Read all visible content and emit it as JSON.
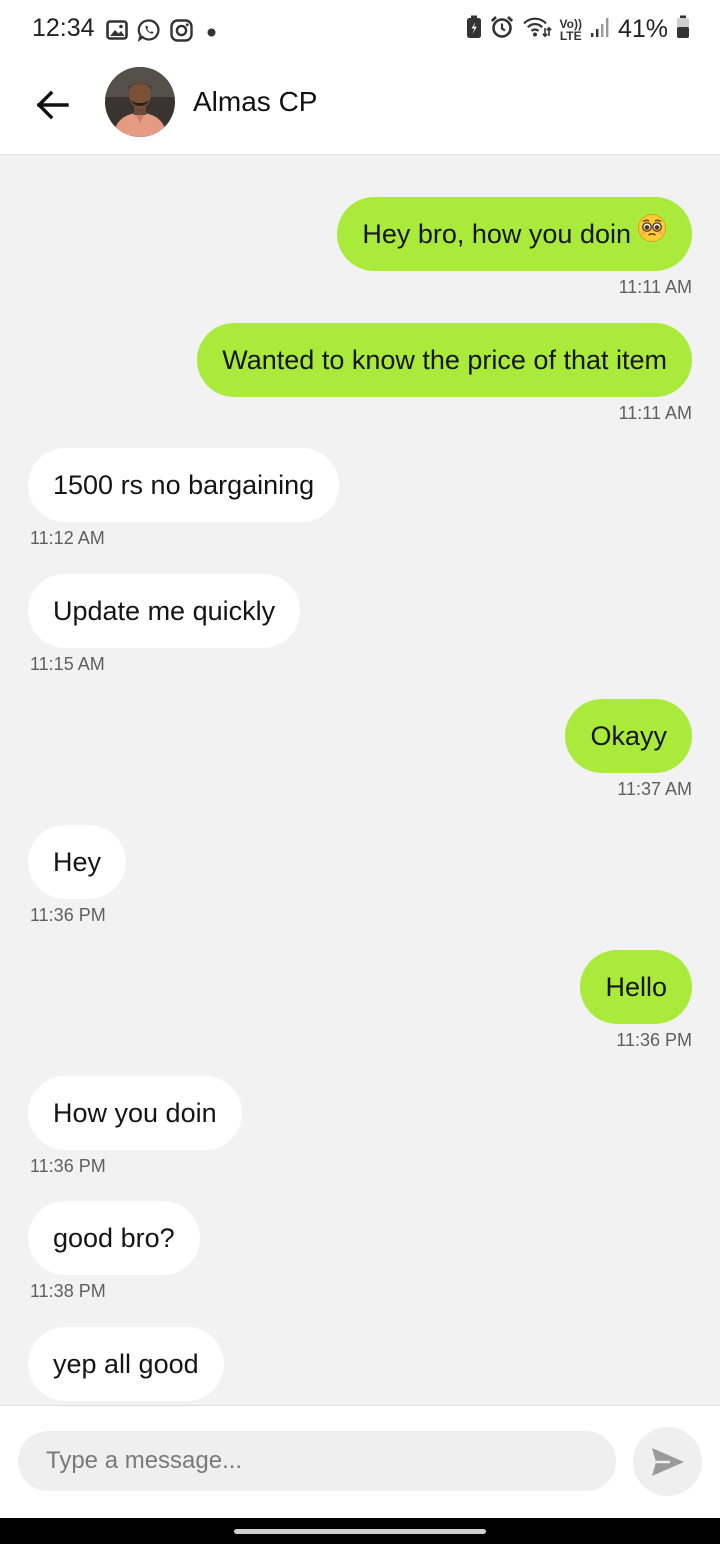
{
  "status_bar": {
    "time": "12:34",
    "battery_percent": "41%",
    "network_label_top": "Vo))",
    "network_label_bottom": "LTE",
    "left_icons": [
      "gallery-icon",
      "whatsapp-icon",
      "instagram-icon",
      "dot-icon"
    ],
    "right_icons": [
      "battery-saver-icon",
      "alarm-icon",
      "wifi-icon",
      "volte-icon",
      "signal-icon",
      "battery-icon"
    ]
  },
  "header": {
    "contact_name": "Almas CP",
    "back_icon": "arrow-left-icon"
  },
  "messages": [
    {
      "direction": "sent",
      "text": "Hey bro, how you doin",
      "emoji": "pleading-face-emoji",
      "time": "11:11 AM"
    },
    {
      "direction": "sent",
      "text": "Wanted to know the price of that item",
      "time": "11:11 AM"
    },
    {
      "direction": "received",
      "text": "1500 rs no bargaining",
      "time": "11:12 AM"
    },
    {
      "direction": "received",
      "text": "Update me quickly",
      "time": "11:15 AM"
    },
    {
      "direction": "sent",
      "text": "Okayy",
      "time": "11:37 AM"
    },
    {
      "direction": "received",
      "text": "Hey",
      "time": "11:36 PM"
    },
    {
      "direction": "sent",
      "text": "Hello",
      "time": "11:36 PM"
    },
    {
      "direction": "received",
      "text": "How you doin",
      "time": "11:36 PM"
    },
    {
      "direction": "received",
      "text": "good bro?",
      "time": "11:38 PM"
    },
    {
      "direction": "received",
      "text": "yep all good",
      "time": ""
    }
  ],
  "composer": {
    "placeholder": "Type a message...",
    "value": "",
    "send_icon": "send-icon"
  },
  "colors": {
    "sent_bubble": "#a9ea3b",
    "received_bubble": "#ffffff",
    "chat_background": "#f2f2f2"
  }
}
